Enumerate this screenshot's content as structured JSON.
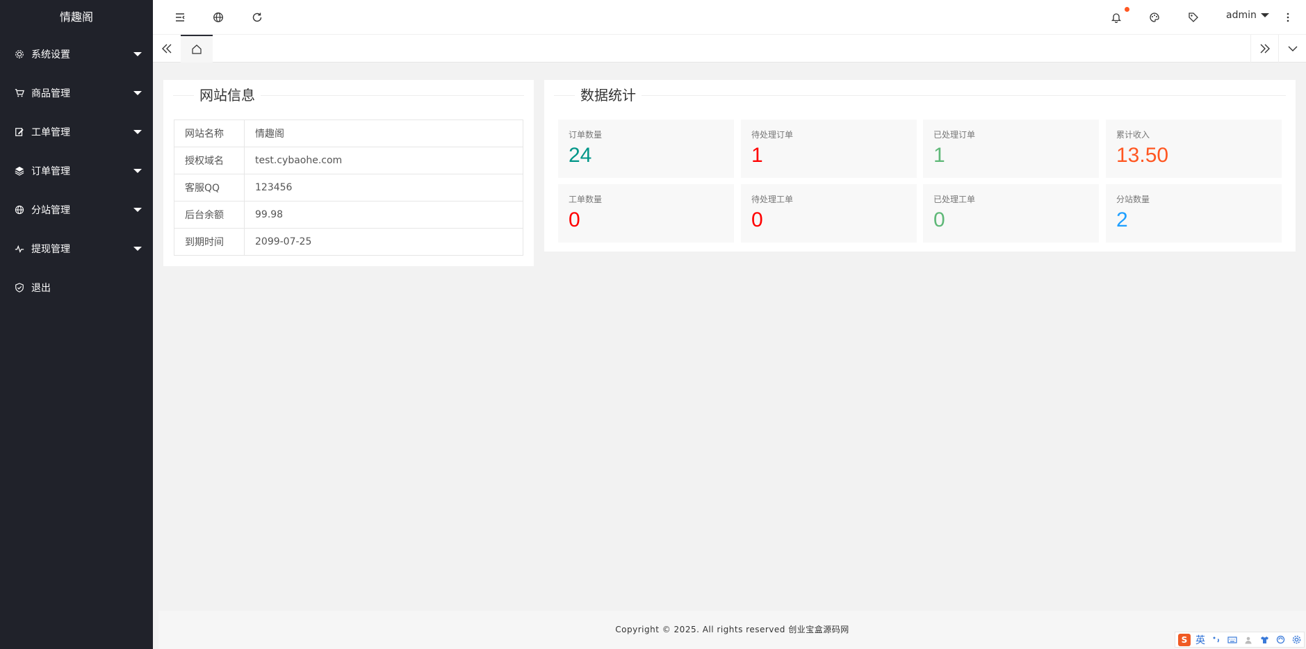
{
  "app": {
    "logo": "情趣阁"
  },
  "sidebar": {
    "items": [
      {
        "label": "系统设置",
        "icon": "gear-icon"
      },
      {
        "label": "商品管理",
        "icon": "cart-icon"
      },
      {
        "label": "工单管理",
        "icon": "edit-icon"
      },
      {
        "label": "订单管理",
        "icon": "layers-icon"
      },
      {
        "label": "分站管理",
        "icon": "globe-icon"
      },
      {
        "label": "提现管理",
        "icon": "pulse-icon"
      },
      {
        "label": "退出",
        "icon": "shield-check-icon"
      }
    ]
  },
  "header": {
    "user": "admin"
  },
  "site_info": {
    "title": "网站信息",
    "rows": [
      {
        "key": "网站名称",
        "value": "情趣阁"
      },
      {
        "key": "授权域名",
        "value": "test.cybaohe.com"
      },
      {
        "key": "客服QQ",
        "value": "123456"
      },
      {
        "key": "后台余额",
        "value": "99.98"
      },
      {
        "key": "到期时间",
        "value": "2099-07-25"
      }
    ]
  },
  "stats": {
    "title": "数据统计",
    "items": [
      {
        "label": "订单数量",
        "value": "24",
        "color": "#009688"
      },
      {
        "label": "待处理订单",
        "value": "1",
        "color": "#ff0000"
      },
      {
        "label": "已处理订单",
        "value": "1",
        "color": "#5fb878"
      },
      {
        "label": "累计收入",
        "value": "13.50",
        "color": "#ff5722"
      },
      {
        "label": "工单数量",
        "value": "0",
        "color": "#ff0000"
      },
      {
        "label": "待处理工单",
        "value": "0",
        "color": "#ff0000"
      },
      {
        "label": "已处理工单",
        "value": "0",
        "color": "#5fb878"
      },
      {
        "label": "分站数量",
        "value": "2",
        "color": "#1e9fff"
      }
    ]
  },
  "footer": {
    "text": "Copyright © 2025. All rights reserved 创业宝盒源码网"
  },
  "ime": {
    "logo": "S",
    "mode": "英"
  }
}
